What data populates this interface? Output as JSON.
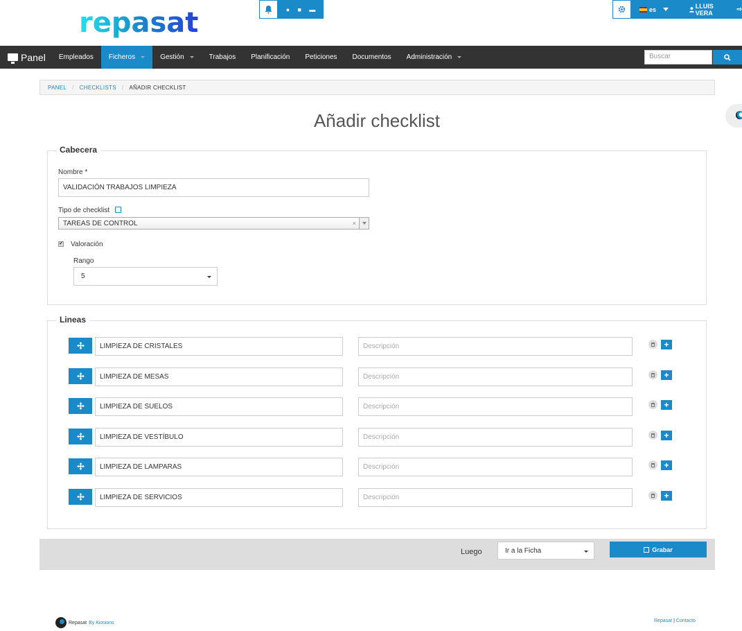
{
  "header": {
    "logo_text": "repasat",
    "language": "es",
    "user_name": "LLUIS VERA"
  },
  "nav": {
    "brand": "Panel",
    "items": [
      {
        "label": "Empleados",
        "active": false,
        "dropdown": false
      },
      {
        "label": "Ficheros",
        "active": true,
        "dropdown": true
      },
      {
        "label": "Gestión",
        "active": false,
        "dropdown": true
      },
      {
        "label": "Trabajos",
        "active": false,
        "dropdown": false
      },
      {
        "label": "Planificación",
        "active": false,
        "dropdown": false
      },
      {
        "label": "Peticiones",
        "active": false,
        "dropdown": false
      },
      {
        "label": "Documentos",
        "active": false,
        "dropdown": false
      },
      {
        "label": "Administración",
        "active": false,
        "dropdown": true
      }
    ],
    "search_placeholder": "Buscar"
  },
  "breadcrumb": {
    "items": [
      "PANEL",
      "CHECKLISTS"
    ],
    "current": "AÑADIR CHECKLIST"
  },
  "page_title": "Añadir checklist",
  "cabecera": {
    "legend": "Cabecera",
    "nombre_label": "Nombre *",
    "nombre_value": "VALIDACIÓN TRABAJOS LIMPIEZA",
    "tipo_label": "Tipo de checklist",
    "tipo_value": "TAREAS DE CONTROL",
    "clear_glyph": "×",
    "valoracion_label": "Valoración",
    "valoracion_checked": true,
    "check_glyph": "✔",
    "rango_label": "Rango",
    "rango_value": "5"
  },
  "lineas": {
    "legend": "Lineas",
    "description_placeholder": "Descripción",
    "items": [
      {
        "name": "LIMPIEZA DE CRISTALES",
        "description": ""
      },
      {
        "name": "LIMPIEZA DE MESAS",
        "description": ""
      },
      {
        "name": "LIMPIEZA DE SUELOS",
        "description": ""
      },
      {
        "name": "LIMPIEZA DE VESTÍBULO",
        "description": ""
      },
      {
        "name": "LIMPIEZA DE LAMPARAS",
        "description": ""
      },
      {
        "name": "LIMPIEZA DE SERVICIOS",
        "description": ""
      }
    ],
    "add_glyph": "+"
  },
  "actions": {
    "luego_label": "Luego",
    "luego_value": "Ir a la Ficha",
    "save_label": "Grabar"
  },
  "footer": {
    "brand": "Repasat",
    "by": "By Kiosions",
    "links": [
      "Repasat",
      "Contacto"
    ]
  },
  "colors": {
    "accent": "#1b8ac8",
    "navbar": "#333333",
    "action_bar": "#dddddd"
  }
}
